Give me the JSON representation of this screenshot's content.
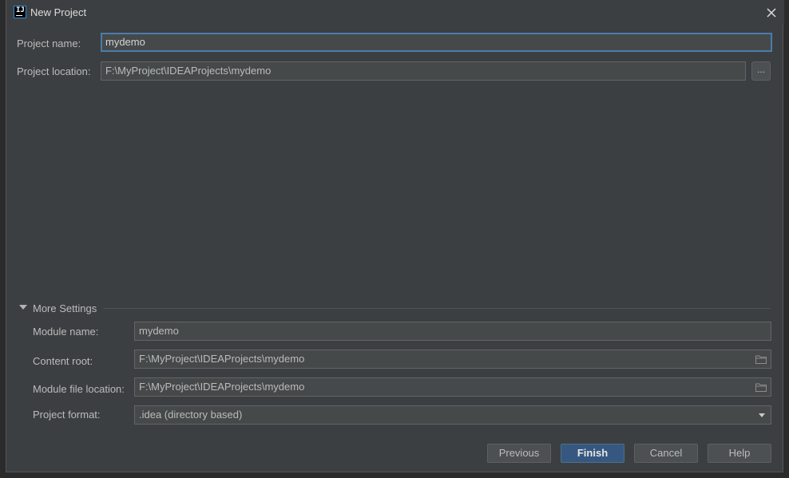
{
  "window": {
    "title": "New Project",
    "app_icon_text": "IJ"
  },
  "form": {
    "project_name_label": "Project name:",
    "project_name_value": "mydemo",
    "project_location_label": "Project location:",
    "project_location_value": "F:\\MyProject\\IDEAProjects\\mydemo",
    "browse_label": "..."
  },
  "more_settings": {
    "title": "More Settings",
    "module_name_label": "Module name:",
    "module_name_value": "mydemo",
    "content_root_label": "Content root:",
    "content_root_value": "F:\\MyProject\\IDEAProjects\\mydemo",
    "module_file_location_label": "Module file location:",
    "module_file_location_value": "F:\\MyProject\\IDEAProjects\\mydemo",
    "project_format_label": "Project format:",
    "project_format_value": ".idea (directory based)"
  },
  "buttons": {
    "previous": "Previous",
    "finish": "Finish",
    "cancel": "Cancel",
    "help": "Help"
  },
  "colors": {
    "background": "#3c3f41",
    "accent": "#365880",
    "focus": "#4b7cab"
  }
}
